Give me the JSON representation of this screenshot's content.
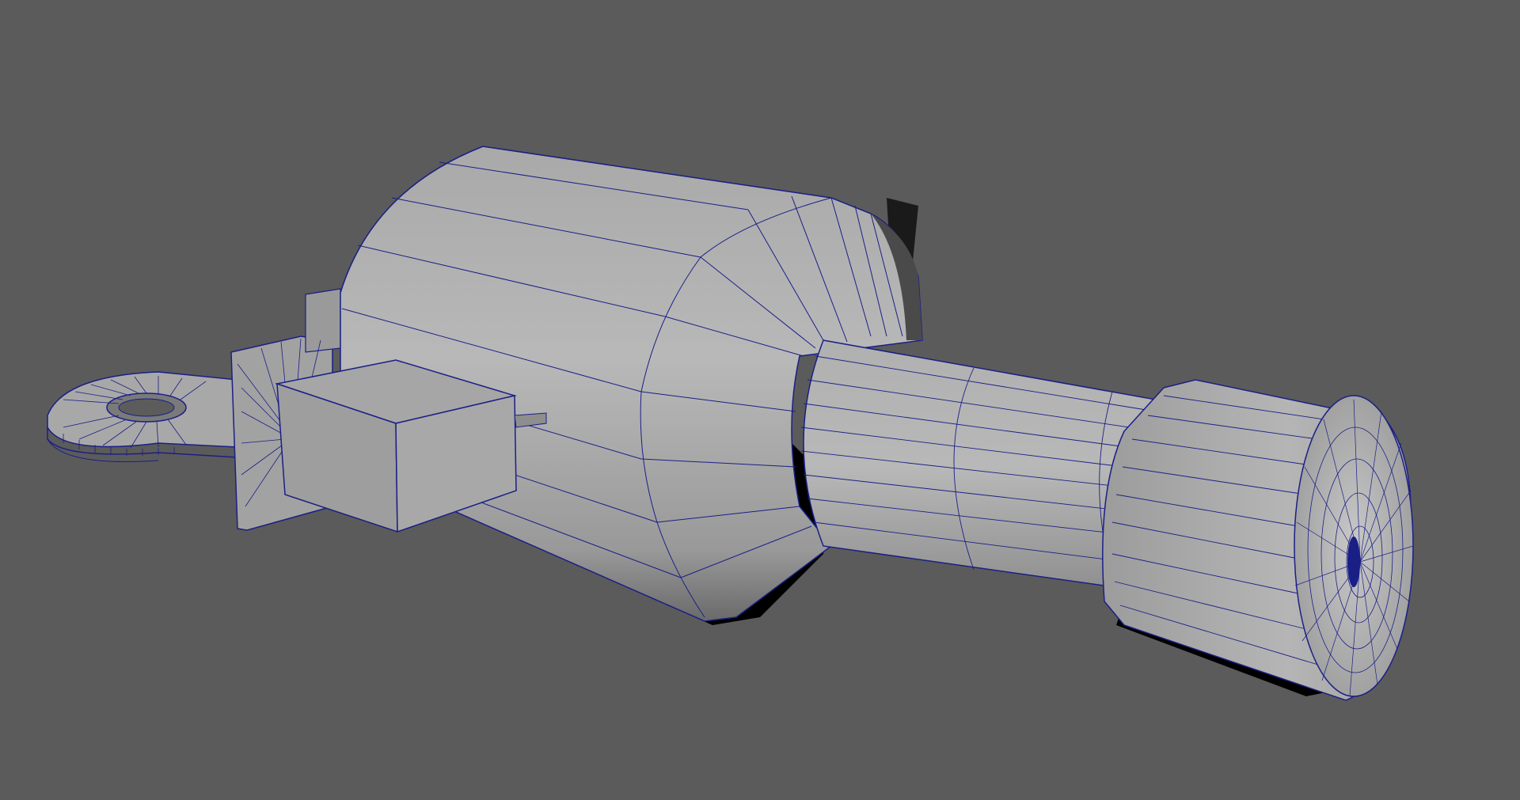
{
  "viewport": {
    "mode": "perspective",
    "shading": "smooth-shade-with-wireframe-on-shaded",
    "object": "mesh-wireframe",
    "colors": {
      "background": "#5b5b5b",
      "surface_light": "#b9b9b9",
      "surface_mid": "#9c9c9c",
      "surface_dark": "#6e6e6e",
      "wire": "#1a1f86",
      "shadow": "#000000"
    }
  }
}
